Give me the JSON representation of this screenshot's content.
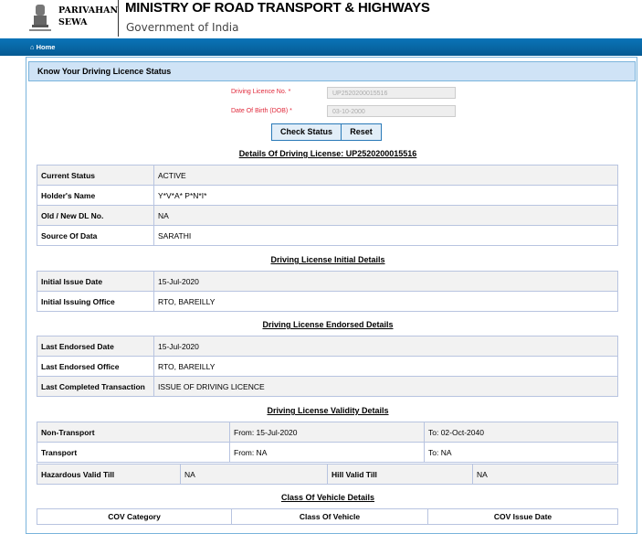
{
  "header": {
    "brand_line1": "PARIVAHAN",
    "brand_line2": "SEWA",
    "ministry": "MINISTRY OF ROAD TRANSPORT & HIGHWAYS",
    "government": "Government of India"
  },
  "nav": {
    "home": "Home"
  },
  "panel": {
    "title": "Know Your Driving Licence Status"
  },
  "form": {
    "dl_label": "Driving Licence No. *",
    "dl_value": "UP2520200015516",
    "dob_label": "Date Of Birth (DOB) *",
    "dob_value": "03-10-2000",
    "check": "Check Status",
    "reset": "Reset"
  },
  "details": {
    "heading": "Details Of Driving License: UP2520200015516",
    "rows": [
      {
        "k": "Current Status",
        "v": "ACTIVE"
      },
      {
        "k": "Holder's Name",
        "v": "Y*V*A* P*N*I*"
      },
      {
        "k": "Old / New DL No.",
        "v": "NA"
      },
      {
        "k": "Source Of Data",
        "v": "SARATHI"
      }
    ]
  },
  "initial": {
    "heading": "Driving License Initial Details",
    "rows": [
      {
        "k": "Initial Issue Date",
        "v": "15-Jul-2020"
      },
      {
        "k": "Initial Issuing Office",
        "v": "RTO, BAREILLY"
      }
    ]
  },
  "endorsed": {
    "heading": "Driving License Endorsed Details",
    "rows": [
      {
        "k": "Last Endorsed Date",
        "v": "15-Jul-2020"
      },
      {
        "k": "Last Endorsed Office",
        "v": "RTO, BAREILLY"
      },
      {
        "k": "Last Completed Transaction",
        "v": "ISSUE OF DRIVING LICENCE"
      }
    ]
  },
  "validity": {
    "heading": "Driving License Validity Details",
    "rows": [
      {
        "k": "Non-Transport",
        "from": "From: 15-Jul-2020",
        "to": "To: 02-Oct-2040"
      },
      {
        "k": "Transport",
        "from": "From: NA",
        "to": "To: NA"
      }
    ],
    "hazardous_label": "Hazardous Valid Till",
    "hazardous_value": "NA",
    "hill_label": "Hill Valid Till",
    "hill_value": "NA"
  },
  "cov": {
    "heading": "Class Of Vehicle Details",
    "columns": [
      "COV Category",
      "Class Of Vehicle",
      "COV Issue Date"
    ]
  }
}
